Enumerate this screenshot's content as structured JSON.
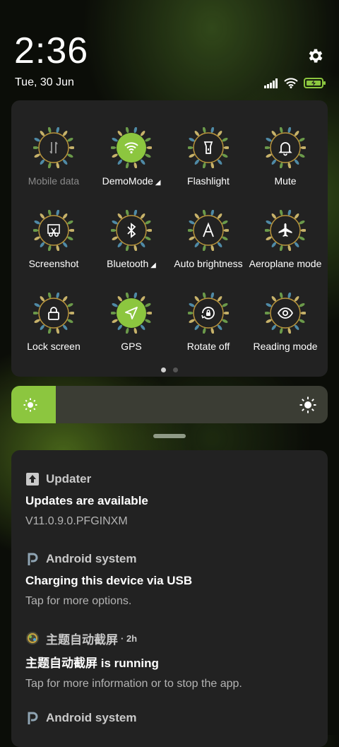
{
  "status": {
    "time": "2:36",
    "date": "Tue, 30 Jun",
    "icons": [
      "signal-icon",
      "wifi-icon",
      "battery-charging-icon"
    ]
  },
  "quick_settings": {
    "tiles": [
      {
        "label": "Mobile data",
        "icon": "mobile-data-icon",
        "active": false,
        "disabled": true
      },
      {
        "label": "DemoMode",
        "icon": "wifi-icon",
        "active": true,
        "expandable": true
      },
      {
        "label": "Flashlight",
        "icon": "flashlight-icon",
        "active": false
      },
      {
        "label": "Mute",
        "icon": "bell-icon",
        "active": false
      },
      {
        "label": "Screenshot",
        "icon": "scissors-icon",
        "active": false
      },
      {
        "label": "Bluetooth",
        "icon": "bluetooth-icon",
        "active": false,
        "expandable": true
      },
      {
        "label": "Auto brightness",
        "icon": "auto-brightness-icon",
        "active": false
      },
      {
        "label": "Aeroplane mode",
        "icon": "airplane-icon",
        "active": false
      },
      {
        "label": "Lock screen",
        "icon": "lock-icon",
        "active": false
      },
      {
        "label": "GPS",
        "icon": "location-arrow-icon",
        "active": true
      },
      {
        "label": "Rotate off",
        "icon": "rotate-lock-icon",
        "active": false
      },
      {
        "label": "Reading mode",
        "icon": "eye-icon",
        "active": false
      }
    ],
    "page_count": 2,
    "current_page": 1
  },
  "brightness": {
    "level": 0.14,
    "accent": "#8cc63f"
  },
  "notifications": [
    {
      "app": "Updater",
      "icon": "updater-icon",
      "time": "",
      "title": "Updates are available",
      "body": "V11.0.9.0.PFGINXM"
    },
    {
      "app": "Android system",
      "icon": "android-system-icon",
      "time": "",
      "title": "Charging this device via USB",
      "body": "Tap for more options."
    },
    {
      "app": "主题自动截屏",
      "icon": "theme-app-icon",
      "time": "· 2h",
      "title": "主题自动截屏 is running",
      "body": "Tap for more information or to stop the app."
    },
    {
      "app": "Android system",
      "icon": "android-system-icon",
      "time": "",
      "title": "",
      "body": ""
    }
  ]
}
